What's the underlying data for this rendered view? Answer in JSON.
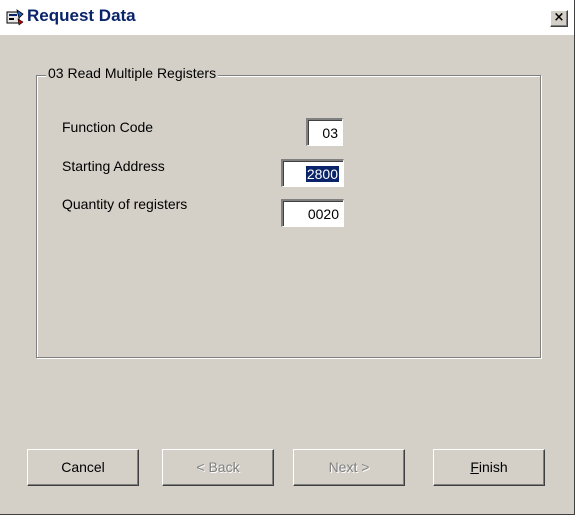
{
  "window": {
    "title": "Request Data",
    "close_label": "×"
  },
  "group": {
    "label": "03  Read Multiple Registers"
  },
  "fields": {
    "function_code": {
      "label": "Function Code",
      "value": "03"
    },
    "starting_address": {
      "label": "Starting Address",
      "value": "2800"
    },
    "quantity": {
      "label": "Quantity of registers",
      "value": "0020"
    }
  },
  "buttons": {
    "cancel": "Cancel",
    "back": "< Back",
    "next": "Next >",
    "finish_mnemonic": "F",
    "finish_rest": "inish"
  },
  "colors": {
    "face": "#d4d0c8",
    "title_text": "#0a246a",
    "selection": "#0a246a",
    "disabled_text": "#808080"
  }
}
